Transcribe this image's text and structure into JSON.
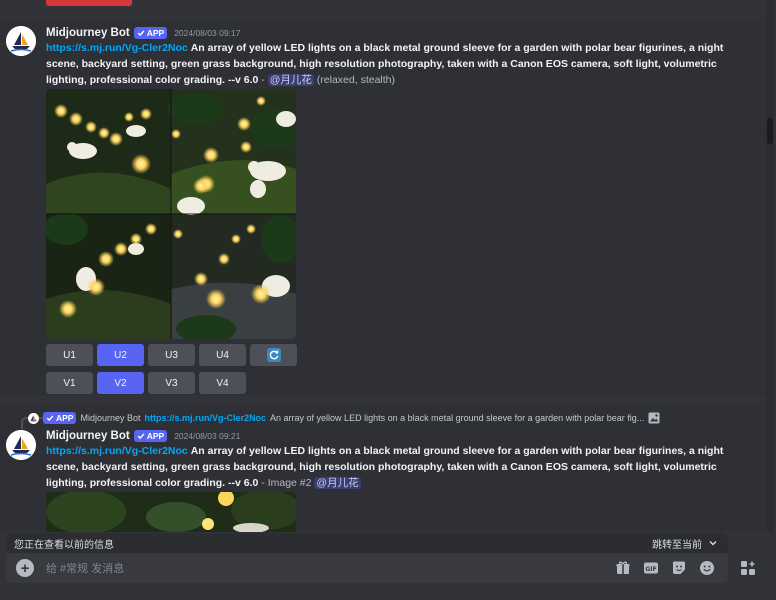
{
  "colors": {
    "background": "#313338",
    "link": "#00a8fc",
    "accent": "#5865f2",
    "button": "#4e5058"
  },
  "message1": {
    "username": "Midjourney Bot",
    "badge": "APP",
    "timestamp": "2024/08/03 09:17",
    "link": "https://s.mj.run/Vg-Cler2Noc",
    "prompt": "An array of yellow LED lights on a black metal ground sleeve for a garden with polar bear figurines, a night scene, backyard setting, green grass background, high resolution photography, taken with a Canon EOS camera, soft light, volumetric lighting, professional color grading. --v 6.0",
    "separator": "-",
    "mention": "@月儿花",
    "meta": "(relaxed, stealth)",
    "upscale_buttons": [
      "U1",
      "U2",
      "U3",
      "U4"
    ],
    "variation_buttons": [
      "V1",
      "V2",
      "V3",
      "V4"
    ],
    "reroll_icon": "refresh-icon"
  },
  "message2": {
    "reply": {
      "badge": "APP",
      "username": "Midjourney Bot",
      "link": "https://s.mj.run/Vg-Cler2Noc",
      "text": "An array of yellow LED lights on a black metal ground sleeve for a garden with polar bear fig..."
    },
    "username": "Midjourney Bot",
    "badge": "APP",
    "timestamp": "2024/08/03 09:21",
    "link": "https://s.mj.run/Vg-Cler2Noc",
    "prompt": "An array of yellow LED lights on a black metal ground sleeve for a garden with polar bear figurines, a night scene, backyard setting, green grass background, high resolution photography, taken with a Canon EOS camera, soft light, volumetric lighting, professional color grading. --v 6.0",
    "separator": "-",
    "meta": "Image #2",
    "mention": "@月儿花"
  },
  "history_bar": {
    "text": "您正在查看以前的信息",
    "jump": "跳转至当前"
  },
  "composer": {
    "placeholder": "给 #常规 发消息",
    "icons": [
      "gift-icon",
      "gif-icon",
      "sticker-icon",
      "emoji-icon",
      "apps-icon"
    ]
  }
}
